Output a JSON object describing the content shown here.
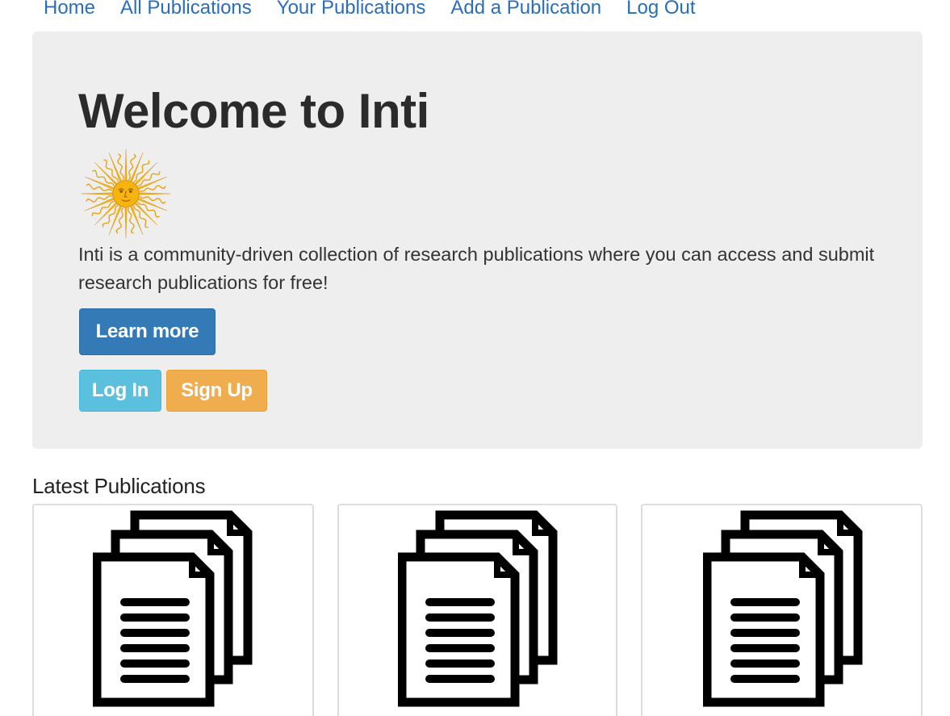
{
  "nav": {
    "links": [
      {
        "label": "Home"
      },
      {
        "label": "All Publications"
      },
      {
        "label": "Your Publications"
      },
      {
        "label": "Add a Publication"
      },
      {
        "label": "Log Out"
      }
    ]
  },
  "jumbotron": {
    "title": "Welcome to Inti",
    "logo_icon": "sun-of-may-icon",
    "description": "Inti is a community-driven collection of research publications where you can access and submit research publications for free!",
    "learn_more_label": "Learn more",
    "login_label": "Log In",
    "signup_label": "Sign Up"
  },
  "latest": {
    "heading": "Latest Publications",
    "cards": [
      {
        "icon": "documents-icon"
      },
      {
        "icon": "documents-icon"
      },
      {
        "icon": "documents-icon"
      }
    ]
  },
  "colors": {
    "link": "#2a6ebb",
    "jumbotron_bg": "#eeeeee",
    "primary": "#337ab7",
    "info": "#5bc0de",
    "warning": "#f0ad4e",
    "sun": "#f6b40e"
  }
}
